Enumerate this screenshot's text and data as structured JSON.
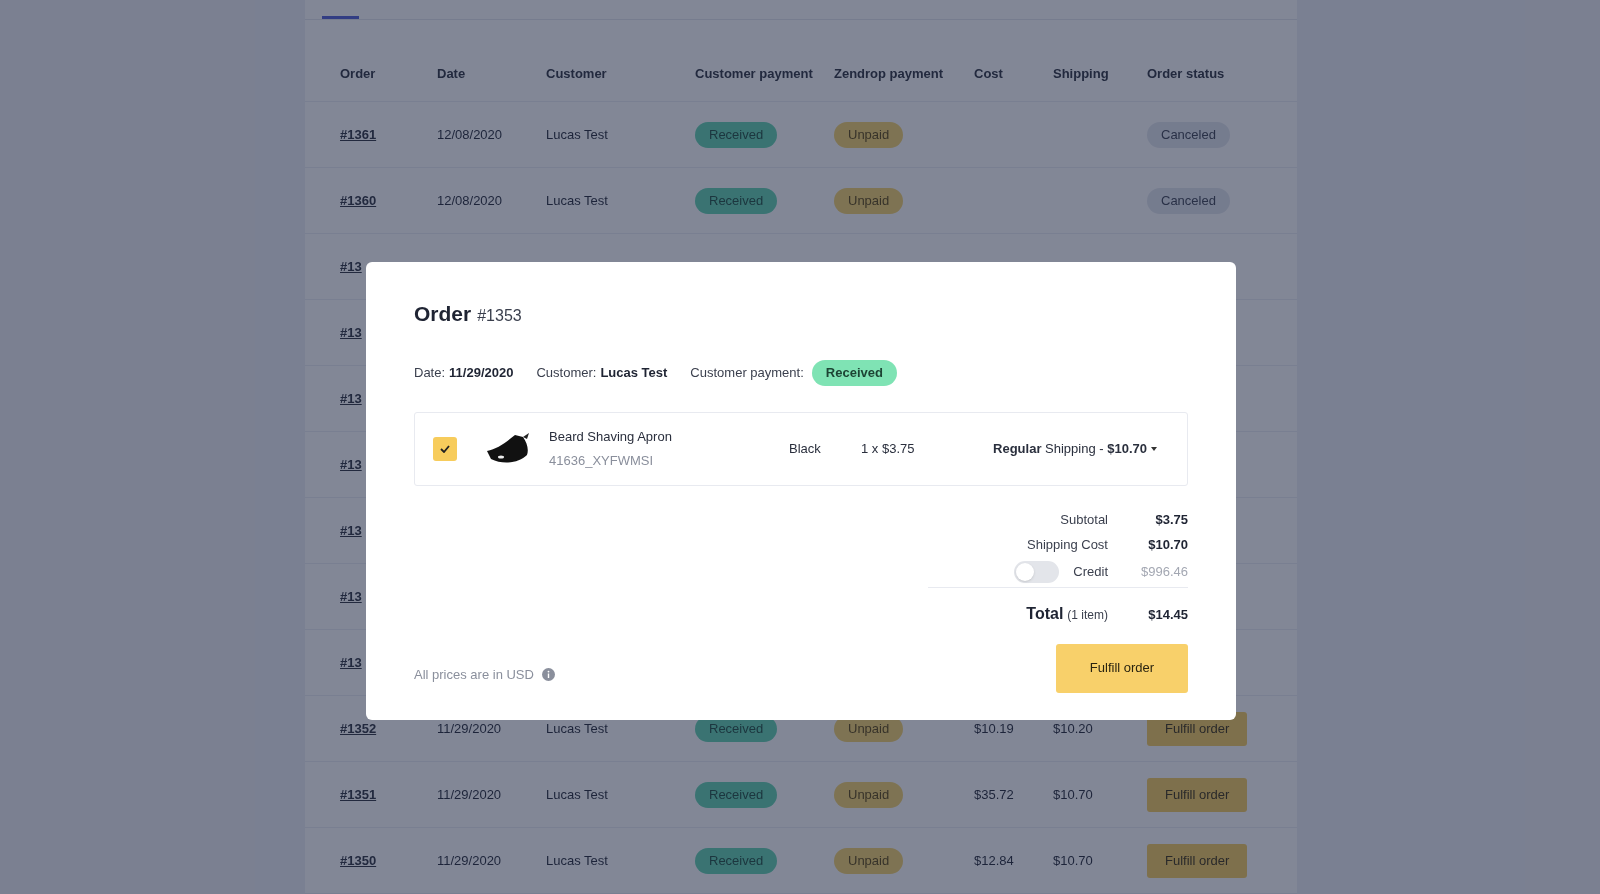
{
  "table": {
    "columns": [
      "Order",
      "Date",
      "Customer",
      "Customer payment",
      "Zendrop payment",
      "Cost",
      "Shipping",
      "Order status"
    ],
    "rows": [
      {
        "order": "#1361",
        "date": "12/08/2020",
        "customer": "Lucas Test",
        "customer_payment": "Received",
        "zendrop_payment": "Unpaid",
        "status": {
          "kind": "badge",
          "label": "Canceled"
        }
      },
      {
        "order": "#1360",
        "date": "12/08/2020",
        "customer": "Lucas Test",
        "customer_payment": "Received",
        "zendrop_payment": "Unpaid",
        "status": {
          "kind": "badge",
          "label": "Canceled"
        }
      },
      {
        "order": "#13"
      },
      {
        "order": "#13"
      },
      {
        "order": "#13"
      },
      {
        "order": "#13"
      },
      {
        "order": "#13"
      },
      {
        "order": "#13"
      },
      {
        "order": "#13"
      },
      {
        "order": "#1352",
        "date": "11/29/2020",
        "customer": "Lucas Test",
        "customer_payment": "Received",
        "zendrop_payment": "Unpaid",
        "cost": "$10.19",
        "shipping": "$10.20",
        "status": {
          "kind": "button",
          "label": "Fulfill order"
        }
      },
      {
        "order": "#1351",
        "date": "11/29/2020",
        "customer": "Lucas Test",
        "customer_payment": "Received",
        "zendrop_payment": "Unpaid",
        "cost": "$35.72",
        "shipping": "$10.70",
        "status": {
          "kind": "button",
          "label": "Fulfill order"
        }
      },
      {
        "order": "#1350",
        "date": "11/29/2020",
        "customer": "Lucas Test",
        "customer_payment": "Received",
        "zendrop_payment": "Unpaid",
        "cost": "$12.84",
        "shipping": "$10.70",
        "status": {
          "kind": "button",
          "label": "Fulfill order"
        }
      }
    ]
  },
  "modal": {
    "title": "Order",
    "number": "#1353",
    "meta": [
      {
        "label": "Date:",
        "value": "11/29/2020"
      },
      {
        "label": "Customer:",
        "value": "Lucas Test"
      },
      {
        "label": "Customer payment:",
        "badge": "Received"
      }
    ],
    "item": {
      "checked": true,
      "name": "Beard Shaving Apron",
      "sku": "41636_XYFWMSI",
      "variant": "Black",
      "quantity": "1 x $3.75",
      "shipping": "**Regular** Shipping - **$10.70**"
    },
    "summary": [
      {
        "label": "Subtotal",
        "value": "$3.75"
      },
      {
        "label": "Shipping Cost",
        "value": "$10.70"
      }
    ],
    "credit": {
      "label": "Credit",
      "value": "$996.46",
      "on": false
    },
    "total": {
      "label": "Total",
      "count": "(1 item)",
      "value": "$14.45"
    },
    "note": "All prices are in USD",
    "button": "Fulfill order"
  }
}
